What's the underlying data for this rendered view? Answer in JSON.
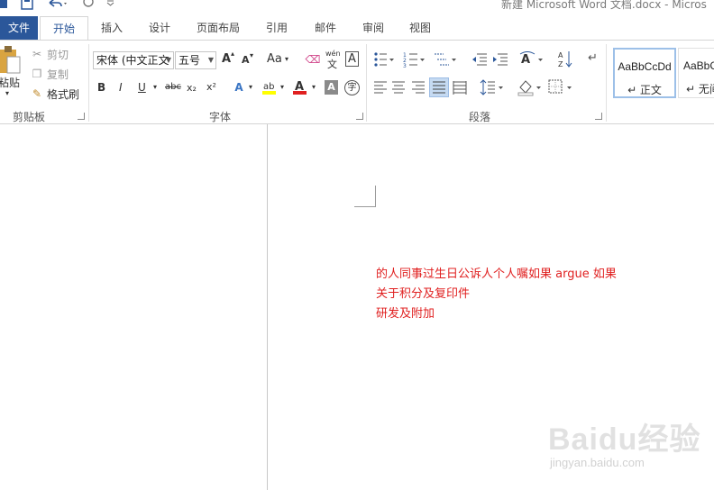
{
  "window": {
    "title": "新建 Microsoft Word 文档.docx - Micros"
  },
  "tabs": [
    "文件",
    "开始",
    "插入",
    "设计",
    "页面布局",
    "引用",
    "邮件",
    "审阅",
    "视图"
  ],
  "clipboard": {
    "paste_label": "粘贴",
    "cut_label": "剪切",
    "copy_label": "复制",
    "format_painter_label": "格式刷",
    "group_label": "剪贴板"
  },
  "font": {
    "font_name": "宋体 (中文正文",
    "font_size": "五号",
    "grow_label": "A",
    "shrink_label": "A",
    "case_label": "Aa",
    "phonetic_label": "wén",
    "border_label": "A",
    "bold": "B",
    "italic": "I",
    "underline": "U",
    "strikethrough": "abc",
    "subscript": "x₂",
    "superscript": "x²",
    "group_label": "字体"
  },
  "paragraph": {
    "group_label": "段落"
  },
  "styles": [
    {
      "sample": "AaBbCcDd",
      "name": "↵ 正文"
    },
    {
      "sample": "AaBbC",
      "name": "↵ 无间"
    }
  ],
  "colors": {
    "file_tab": "#2b579a",
    "highlight": "#ffff00",
    "font_color": "#e02020",
    "doc_text": "#e02020"
  },
  "document": {
    "lines": [
      "的人同事过生日公诉人个人嘱如果 argue 如果",
      "关于积分及复印件",
      "研发及附加"
    ]
  },
  "watermark": {
    "logo": "Baidu经验",
    "url": "jingyan.baidu.com"
  }
}
